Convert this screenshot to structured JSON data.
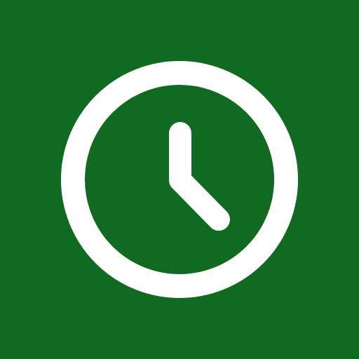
{
  "icon": {
    "name": "clock-icon",
    "background_color": "#106a21",
    "foreground_color": "#ffffff"
  }
}
